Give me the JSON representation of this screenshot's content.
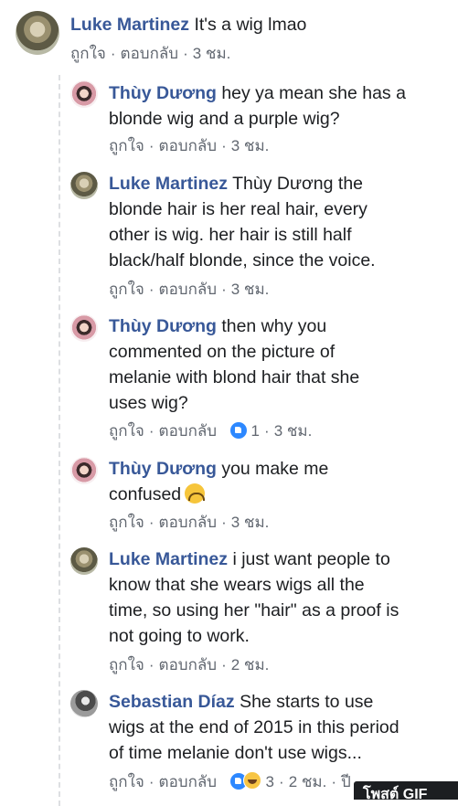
{
  "comments": [
    {
      "name": "Luke Martinez",
      "body": [
        "It's a wig lmao"
      ],
      "like": "ถูกใจ",
      "reply": "ตอบกลับ",
      "time": "3 ชม."
    },
    {
      "name": "Thùy Dương",
      "body": [
        "hey ya mean she has a",
        "blonde wig and a purple wig?"
      ],
      "like": "ถูกใจ",
      "reply": "ตอบกลับ",
      "time": "3 ชม."
    },
    {
      "name": "Luke Martinez",
      "body": [
        "Thùy Dương the",
        "blonde hair is her real hair, every",
        "other is wig. her hair is still half",
        "black/half blonde, since the voice."
      ],
      "like": "ถูกใจ",
      "reply": "ตอบกลับ",
      "time": "3 ชม."
    },
    {
      "name": "Thùy Dương",
      "body": [
        "then why you",
        "commented on the picture of",
        "melanie with blond hair that she",
        "uses wig?"
      ],
      "like": "ถูกใจ",
      "reply": "ตอบกลับ",
      "reactions": "1",
      "time": "3 ชม."
    },
    {
      "name": "Thùy Dương",
      "body": [
        "you make me",
        "confused"
      ],
      "like": "ถูกใจ",
      "reply": "ตอบกลับ",
      "time": "3 ชม."
    },
    {
      "name": "Luke Martinez",
      "body": [
        "i just want people to",
        "know that she wears wigs all the",
        "time, so using her \"hair\" as a proof is",
        "not going to work."
      ],
      "like": "ถูกใจ",
      "reply": "ตอบกลับ",
      "time": "2 ชม."
    },
    {
      "name": "Sebastian Díaz",
      "body": [
        "She starts to use",
        "wigs at the end of 2015 in this period",
        "of time melanie don't use wigs..."
      ],
      "like": "ถูกใจ",
      "reply": "ตอบกลับ",
      "reactions": "3",
      "time": "2 ชม.",
      "extra": "ปี"
    }
  ],
  "gif_button": "โพสต์ GIF",
  "icons": {
    "like": "like-reaction-icon",
    "haha": "haha-reaction-icon",
    "emoji": "upside-down-face-emoji"
  }
}
